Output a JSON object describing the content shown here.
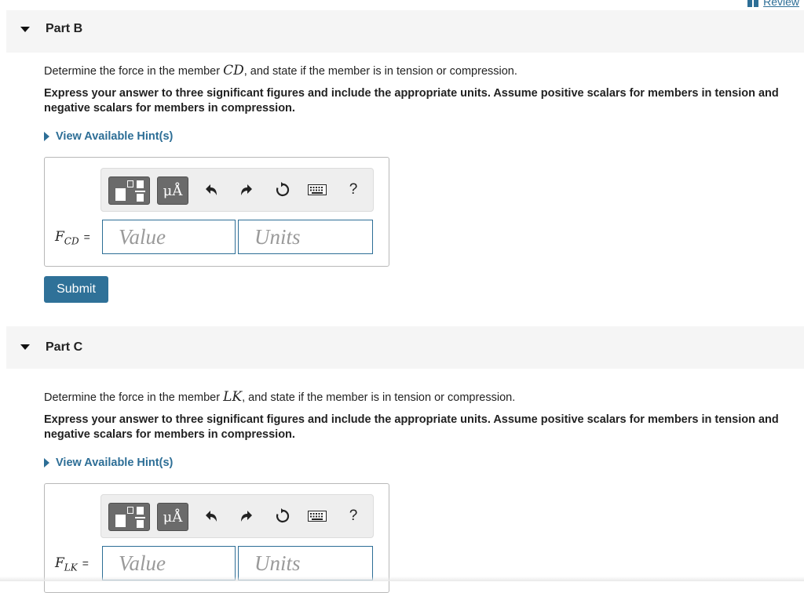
{
  "review": {
    "label": "Review"
  },
  "part_b": {
    "title": "Part B",
    "question_pre": "Determine the force in the member ",
    "member": "CD",
    "question_post": ", and state if the member is in tension or compression.",
    "instructions": "Express your answer to three significant figures and include the appropriate units. Assume positive scalars for members in tension and negative scalars for members in compression.",
    "hint_label": "View Available Hint(s)",
    "var_main": "F",
    "var_sub": "CD",
    "eq": "=",
    "value_placeholder": "Value",
    "units_placeholder": "Units",
    "units_button": "μÅ",
    "help": "?",
    "submit_label": "Submit"
  },
  "part_c": {
    "title": "Part C",
    "question_pre": "Determine the force in the member ",
    "member": "LK",
    "question_post": ", and state if the member is in tension or compression.",
    "instructions": "Express your answer to three significant figures and include the appropriate units. Assume positive scalars for members in tension and negative scalars for members in compression.",
    "hint_label": "View Available Hint(s)",
    "var_main": "F",
    "var_sub": "LK",
    "eq": "=",
    "value_placeholder": "Value",
    "units_placeholder": "Units",
    "units_button": "μÅ",
    "help": "?"
  },
  "colors": {
    "accent": "#2d6e96",
    "submit_bg": "#2f7198",
    "header_bg": "#f5f5f5",
    "toolbar_btn": "#6b6b6b"
  }
}
